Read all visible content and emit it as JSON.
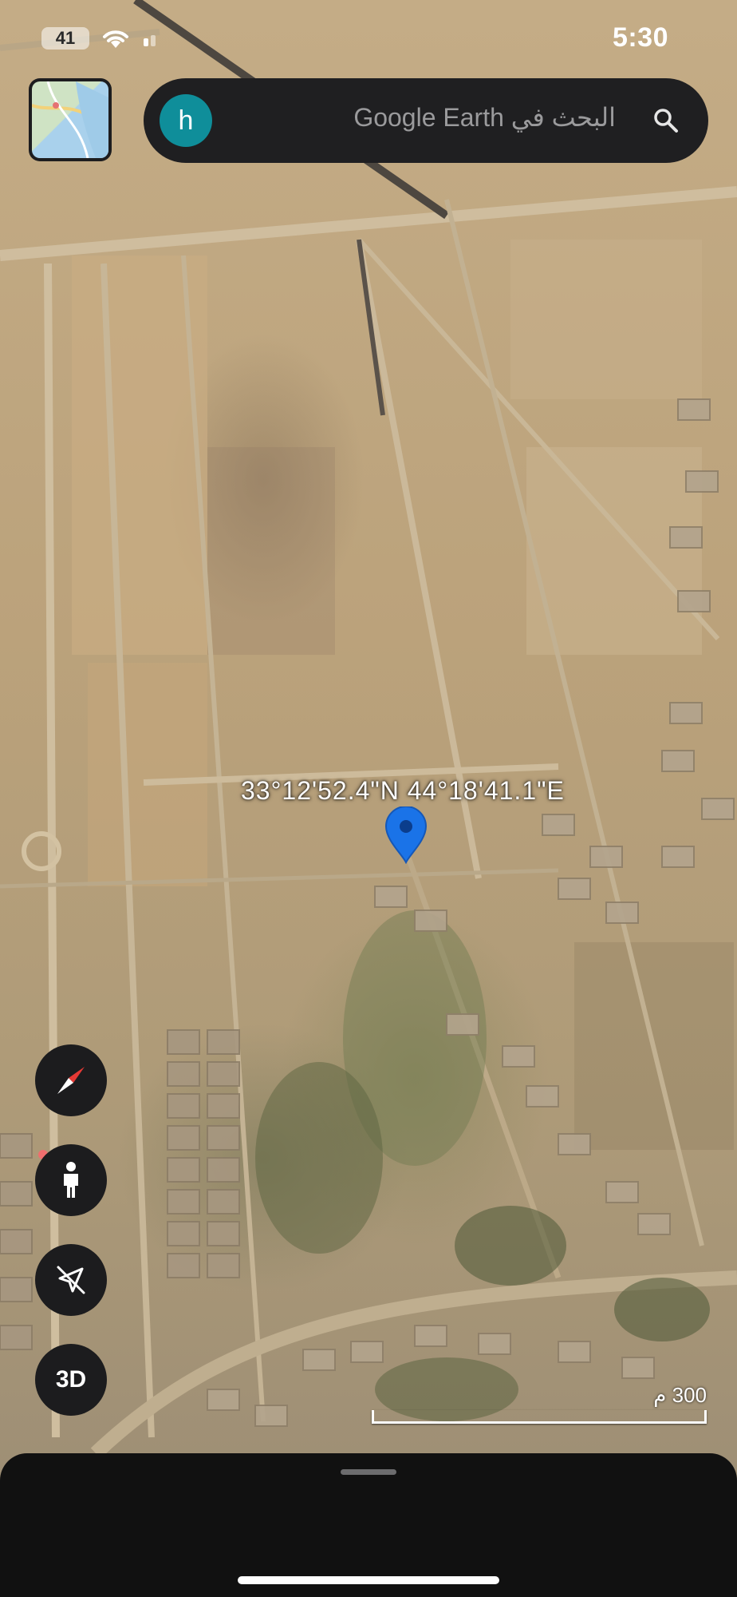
{
  "status_bar": {
    "time": "5:30",
    "battery": "41",
    "icons": [
      "wifi-icon",
      "signal-icon"
    ]
  },
  "top_bar": {
    "layer_thumbnail": "map-style-icon",
    "avatar_initial": "h",
    "search_placeholder": "البحث في Google Earth",
    "search_icon": "search-icon"
  },
  "map": {
    "coordinates": "33°12'52.4\"N 44°18'41.1\"E",
    "pin": "location-pin-icon",
    "scale_label": "300 م"
  },
  "controls": {
    "compass": "compass-icon",
    "street_view": "person-icon",
    "location": "location-off-icon",
    "view_mode_label": "3D"
  },
  "colors": {
    "pin": "#1a73e8",
    "avatar": "#0f8e9a",
    "control_bg": "#1c1c1e",
    "compass_red": "#e53935"
  }
}
